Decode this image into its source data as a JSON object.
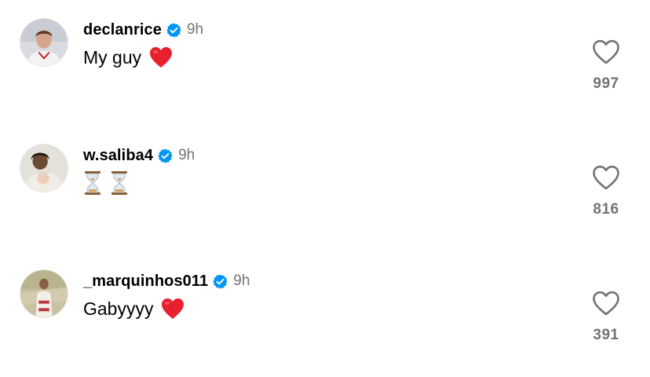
{
  "comments": [
    {
      "username": "declanrice",
      "verified": true,
      "time": "9h",
      "text": "My guy",
      "emoji": "red-heart",
      "likes": "997",
      "avatar_icon": "avatar-photo"
    },
    {
      "username": "w.saliba4",
      "verified": true,
      "time": "9h",
      "text": "",
      "emoji": "hourglass-x2",
      "likes": "816",
      "avatar_icon": "avatar-photo"
    },
    {
      "username": "_marquinhos011",
      "verified": true,
      "time": "9h",
      "text": "Gabyyyy",
      "emoji": "red-heart",
      "likes": "391",
      "avatar_icon": "avatar-photo"
    }
  ],
  "colors": {
    "verified_blue": "#0095f6",
    "secondary_text": "#737373",
    "heart_red": "#e8202e"
  }
}
